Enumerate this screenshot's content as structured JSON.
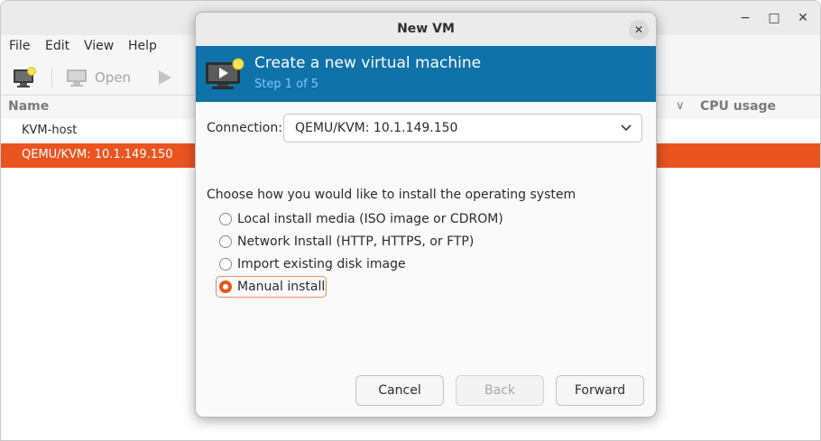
{
  "main_window": {
    "menu": [
      "File",
      "Edit",
      "View",
      "Help"
    ],
    "toolbar": {
      "open_label": "Open"
    },
    "columns": {
      "name": "Name",
      "cpu_usage": "CPU usage"
    },
    "connections": [
      {
        "label": "KVM-host",
        "selected": false
      },
      {
        "label": "QEMU/KVM: 10.1.149.150",
        "selected": true
      }
    ],
    "controls": {
      "minimize": "−",
      "maximize": "□",
      "close": "✕"
    }
  },
  "dialog": {
    "title": "New VM",
    "close_glyph": "✕",
    "banner": {
      "title": "Create a new virtual machine",
      "step": "Step 1 of 5"
    },
    "connection": {
      "label": "Connection:",
      "value": "QEMU/KVM: 10.1.149.150"
    },
    "install_prompt": "Choose how you would like to install the operating system",
    "install_options": [
      {
        "label": "Local install media (ISO image or CDROM)",
        "checked": false
      },
      {
        "label": "Network Install (HTTP, HTTPS, or FTP)",
        "checked": false
      },
      {
        "label": "Import existing disk image",
        "checked": false
      },
      {
        "label": "Manual install",
        "checked": true
      }
    ],
    "buttons": {
      "cancel": "Cancel",
      "back": "Back",
      "forward": "Forward"
    }
  },
  "colors": {
    "accent": "#e95420",
    "banner": "#0f72a8",
    "banner_step": "#7cc8ff"
  },
  "icons": [
    "new-vm-icon",
    "monitor-icon",
    "play-icon",
    "chevron-down-icon",
    "close-icon"
  ]
}
